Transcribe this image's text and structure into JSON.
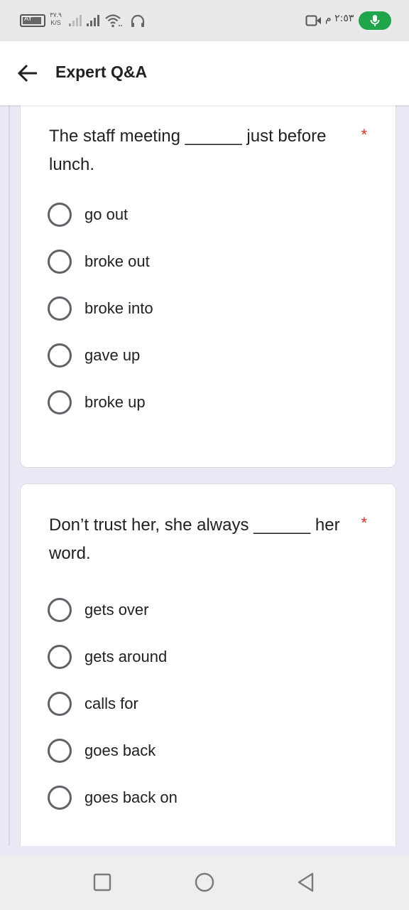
{
  "status_bar": {
    "battery_level": "AY",
    "net_speed_value": "٣٧.٩",
    "net_speed_unit": "K/S",
    "time": "٢:٥٣ م",
    "icons": [
      "battery-icon",
      "signal-icon",
      "signal-icon",
      "wifi-icon",
      "headset-icon",
      "video-camera-icon",
      "microphone-icon"
    ],
    "mic_color": "#1fa64a"
  },
  "app_bar": {
    "title": "Expert Q&A",
    "back_icon": "arrow-left-icon"
  },
  "questions": [
    {
      "text": "The staff meeting ______ just before lunch.",
      "required_mark": "*",
      "options": [
        "go out",
        "broke out",
        "broke into",
        "gave up",
        "broke up"
      ]
    },
    {
      "text": "Don’t trust her, she always ______ her word.",
      "required_mark": "*",
      "options": [
        "gets over",
        "gets around",
        "calls for",
        "goes back",
        "goes back on"
      ]
    }
  ],
  "nav_bar": {
    "icons": [
      "recents-square-icon",
      "home-circle-icon",
      "back-triangle-icon"
    ]
  },
  "colors": {
    "background": "#ece9f7",
    "required": "#d93025",
    "radio_border": "#5f6368"
  }
}
